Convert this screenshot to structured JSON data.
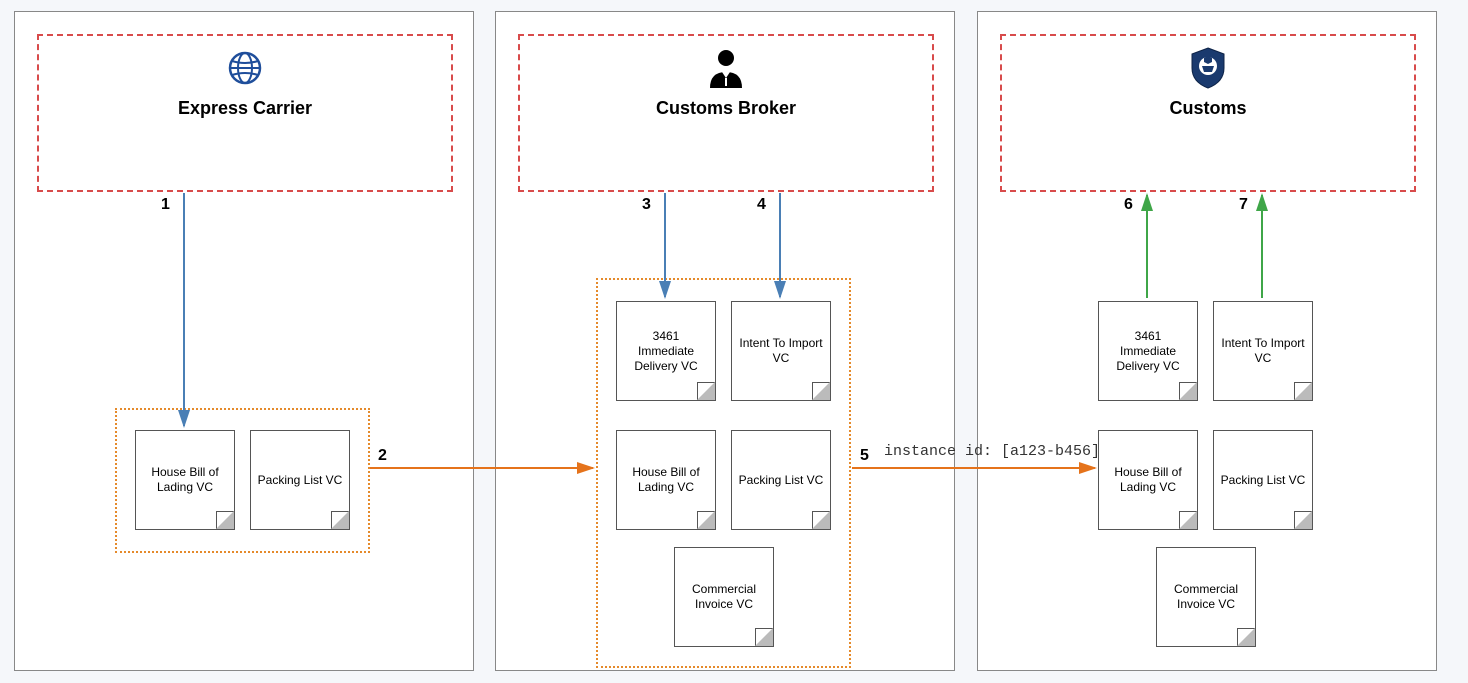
{
  "actors": {
    "carrier": "Express Carrier",
    "broker": "Customs Broker",
    "customs": "Customs"
  },
  "docs": {
    "hbol": "House Bill of Lading VC",
    "packing": "Packing List VC",
    "d3461": "3461 Immediate Delivery VC",
    "intent": "Intent To Import VC",
    "commercial": "Commercial Invoice VC"
  },
  "steps": {
    "s1": "1",
    "s2": "2",
    "s3": "3",
    "s4": "4",
    "s5": "5",
    "s6": "6",
    "s7": "7"
  },
  "annotation": "instance id: [a123-b456]",
  "colors": {
    "blueArrow": "#4a7fb5",
    "orangeArrow": "#e5731b",
    "greenArrow": "#3fa648"
  }
}
